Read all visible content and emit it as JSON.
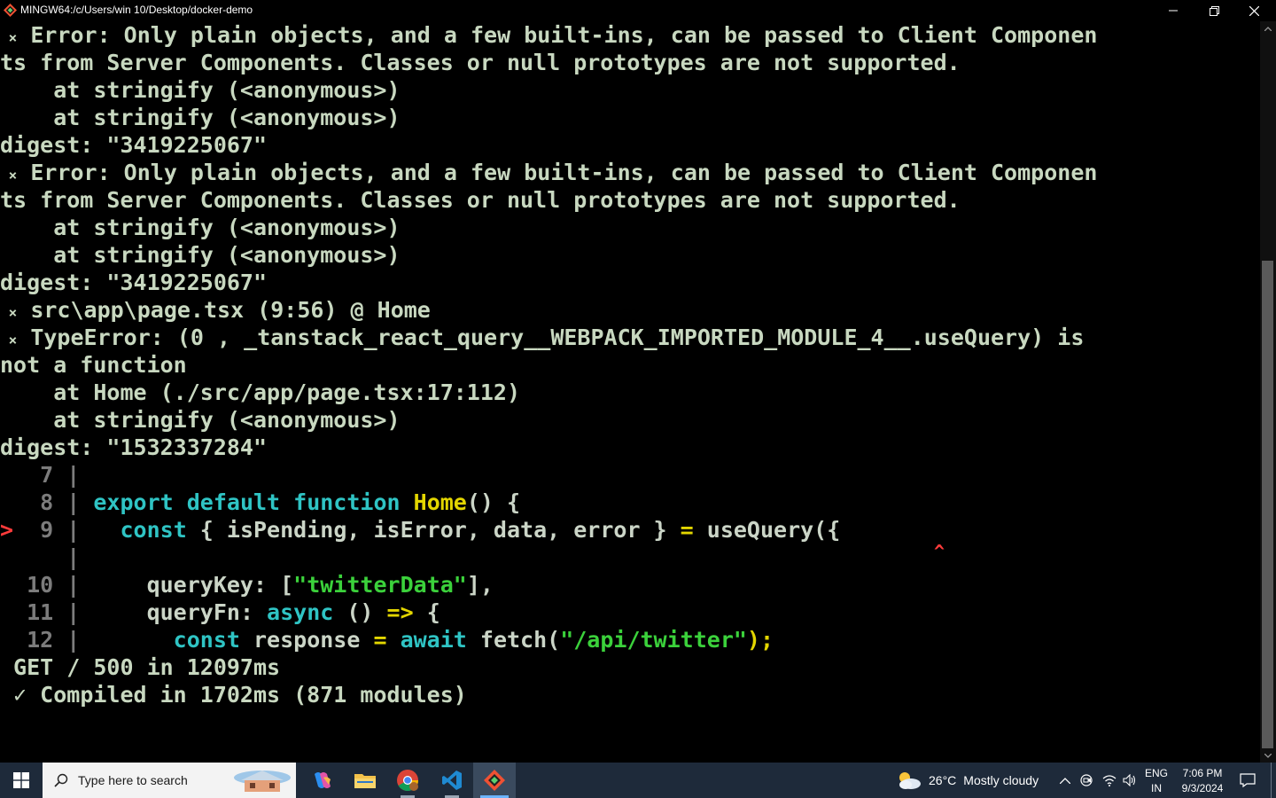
{
  "window": {
    "title": "MINGW64:/c/Users/win 10/Desktop/docker-demo",
    "minimize_icon": "minimize-icon",
    "maximize_icon": "restore-icon",
    "close_icon": "close-icon"
  },
  "terminal": {
    "lines": [
      {
        "x": " ×",
        "text": " Error: Only plain objects, and a few built-ins, can be passed to Client Componen"
      },
      {
        "text": "ts from Server Components. Classes or null prototypes are not supported."
      },
      {
        "text": "    at stringify (<anonymous>)"
      },
      {
        "text": "    at stringify (<anonymous>)"
      },
      {
        "text": "digest: \"3419225067\""
      },
      {
        "x": " ×",
        "text": " Error: Only plain objects, and a few built-ins, can be passed to Client Componen"
      },
      {
        "text": "ts from Server Components. Classes or null prototypes are not supported."
      },
      {
        "text": "    at stringify (<anonymous>)"
      },
      {
        "text": "    at stringify (<anonymous>)"
      },
      {
        "text": "digest: \"3419225067\""
      },
      {
        "x": " ×",
        "text": " src\\app\\page.tsx (9:56) @ Home"
      },
      {
        "x": " ×",
        "text": " TypeError: (0 , _tanstack_react_query__WEBPACK_IMPORTED_MODULE_4__.useQuery) is"
      },
      {
        "text": "not a function"
      },
      {
        "text": "    at Home (./src/app/page.tsx:17:112)"
      },
      {
        "text": "    at stringify (<anonymous>)"
      },
      {
        "text": "digest: \"1532337284\""
      }
    ],
    "code": {
      "l7": {
        "gutter": "   7 |"
      },
      "l8": {
        "gutter": "   8 | ",
        "kw1": "export",
        "sp1": " ",
        "kw2": "default",
        "sp2": " ",
        "kw3": "function",
        "sp3": " ",
        "name": "Home",
        "rest": "() {"
      },
      "l9": {
        "pointer": ">",
        "gutter": "  9 | ",
        "indent": "  ",
        "kw": "const",
        "body": " { isPending, isError, data, error } ",
        "eq": "=",
        "call": " useQuery({"
      },
      "l9b": {
        "gutter": "     |",
        "caret": "^"
      },
      "l10": {
        "gutter": "  10 | ",
        "indent": "    ",
        "key": "queryKey",
        "colon": ": [",
        "str": "\"twitterData\"",
        "end": "],"
      },
      "l11": {
        "gutter": "  11 | ",
        "indent": "    ",
        "key": "queryFn",
        "colon": ": ",
        "kw": "async",
        "mid": " () ",
        "arrow": "=>",
        "end": " {"
      },
      "l12": {
        "gutter": "  12 | ",
        "indent": "      ",
        "kw": "const",
        "mid": " response ",
        "eq": "=",
        "sp": " ",
        "kw2": "await",
        "call": " fetch(",
        "str": "\"/api/twitter\"",
        "end": ");"
      }
    },
    "status1": " GET / 500 in 12097ms",
    "status2_mark": " ✓",
    "status2": " Compiled in 1702ms (871 modules)"
  },
  "taskbar": {
    "search_placeholder": "Type here to search",
    "weather_temp": "26°C",
    "weather_text": "Mostly cloudy",
    "lang1": "ENG",
    "lang2": "IN",
    "time": "7:06 PM",
    "date": "9/3/2024",
    "colors": {
      "bar": "#1e2a3a",
      "accent": "#6cb4ff"
    }
  }
}
